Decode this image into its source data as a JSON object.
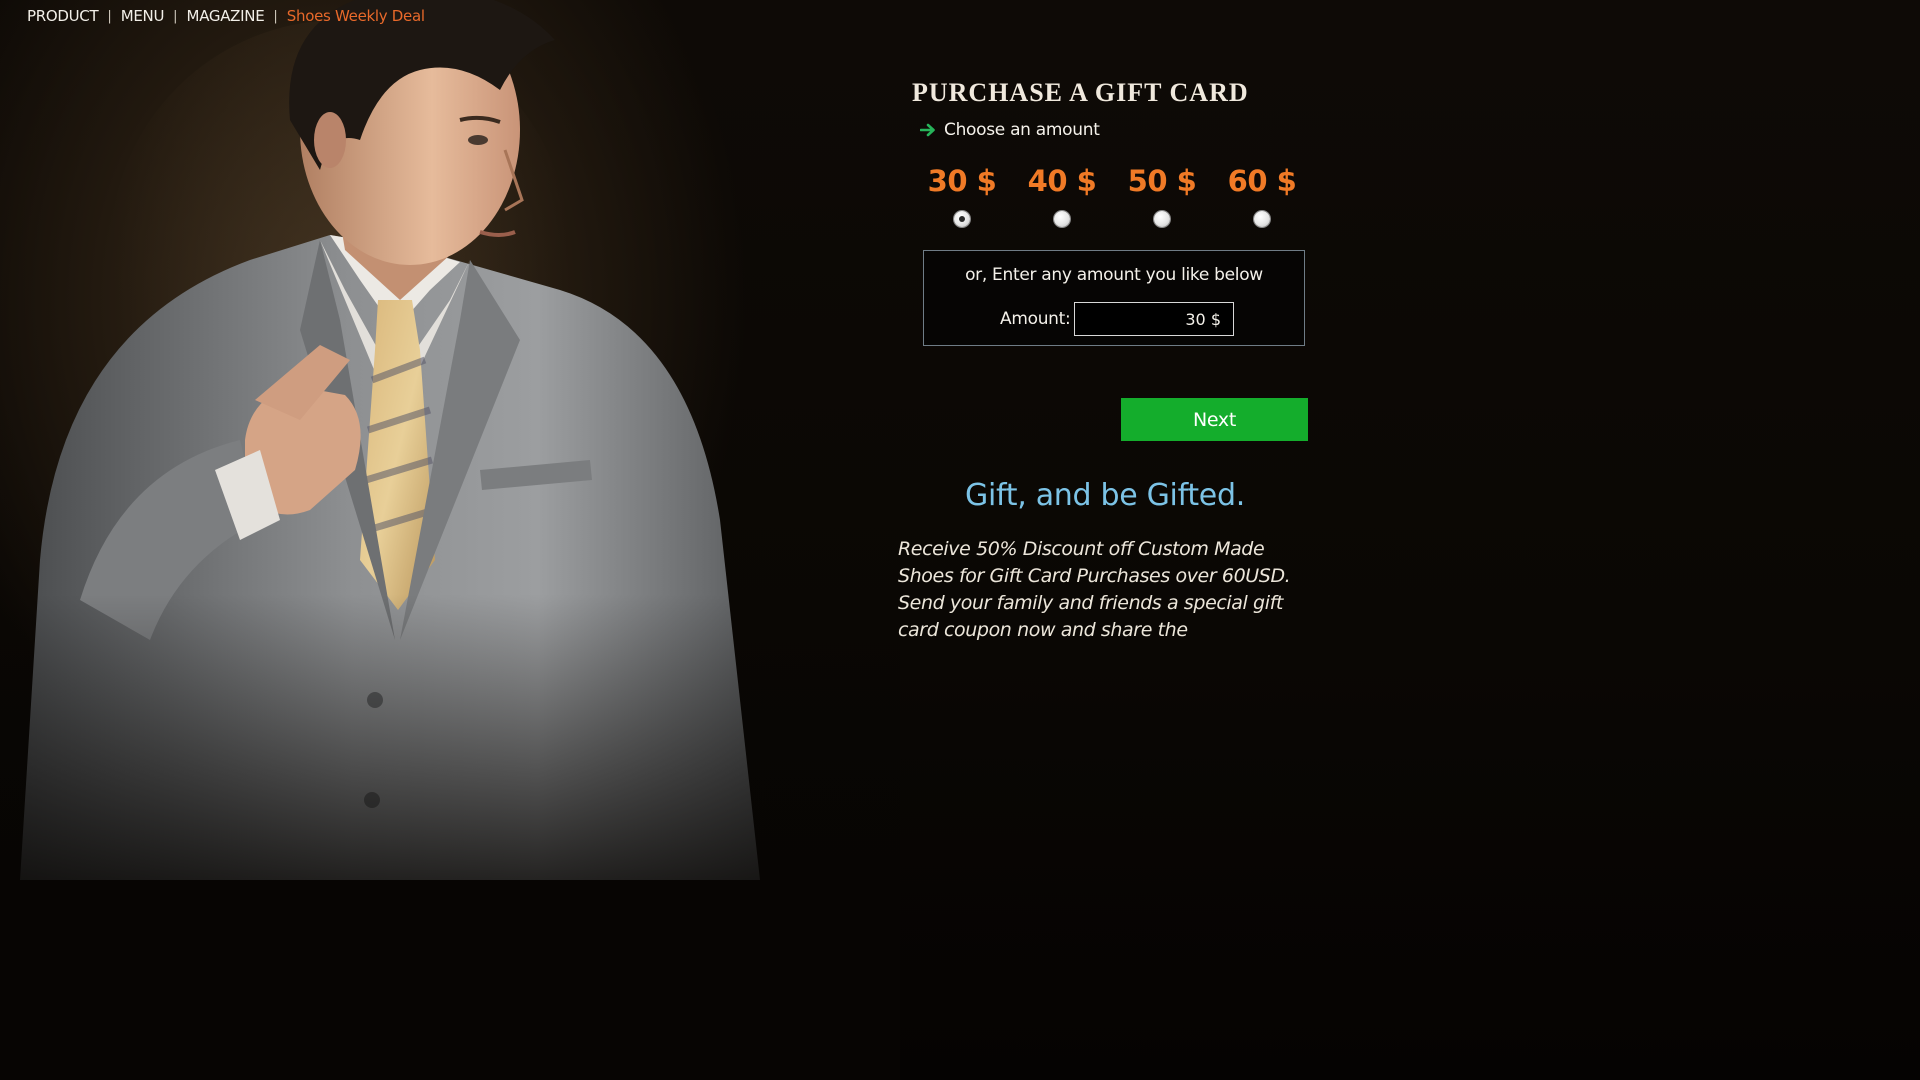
{
  "nav": {
    "items": [
      "PRODUCT",
      "MENU",
      "MAGAZINE"
    ],
    "separator": "|",
    "deal_link": "Shoes Weekly Deal",
    "deal_color": "#e8692a"
  },
  "gift_card": {
    "title": "PURCHASE A GIFT CARD",
    "step_icon": "arrow-right-icon",
    "step_label": "Choose an amount",
    "amounts": [
      {
        "label": "30 $",
        "selected": true
      },
      {
        "label": "40 $",
        "selected": false
      },
      {
        "label": "50 $",
        "selected": false
      },
      {
        "label": "60 $",
        "selected": false
      }
    ],
    "custom_hint": "or, Enter any amount you like below",
    "amount_label": "Amount:",
    "amount_value": "30 $",
    "next_label": "Next",
    "accent_color": "#f07a26",
    "button_color": "#14ad2c"
  },
  "promo": {
    "tagline": "Gift, and be Gifted.",
    "tagline_color": "#7cc3e6",
    "body": "Receive 50% Discount off Custom Made Shoes for Gift Card Purchases over 60USD. Send your family and friends a special gift card coupon now and share the"
  }
}
